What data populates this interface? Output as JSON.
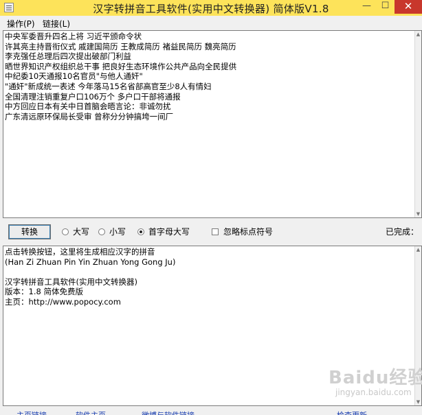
{
  "window": {
    "title": "汉字转拼音工具软件(实用中文转换器) 简体版V1.8",
    "controls": {
      "minimize": "—",
      "maximize": "☐",
      "close": "✕"
    }
  },
  "menu": {
    "items": [
      "操作(P)",
      "链接(L)"
    ]
  },
  "input_lines": [
    "中央军委晋升四名上将 习近平颁命令状",
    "许其亮主持晋衔仪式 戚建国简历 王教成简历 褚益民简历 魏亮简历",
    "李克强任总理后四次提出破部门利益",
    "晒世界知识产权组织总干事 把良好生态环境作公共产品向全民提供",
    "中纪委10天通报10名官员\"与他人通奸\"",
    "\"通奸\"新成统一表述 今年落马15名省部高官至少8人有情妇",
    "全国清理注销重复户口106万个 多户口干部将通报",
    "中方回应日本有关中日首脑会晤言论：非诚勿扰",
    "广东清远原环保局长受审 曾称分分钟搞垮一间厂"
  ],
  "toolbar": {
    "convert_label": "转换",
    "option_uppercase": "大写",
    "option_lowercase": "小写",
    "option_initial_caps": "首字母大写",
    "option_ignore_punct": "忽略标点符号",
    "selected_case": "首字母大写",
    "ignore_punct_checked": false,
    "status_label": "已完成："
  },
  "output_lines": [
    "点击转换按钮，这里将生成相应汉字的拼音",
    "(Han Zi Zhuan Pin Yin Zhuan Yong Gong Ju)",
    "",
    "汉字转拼音工具软件(实用中文转换器)",
    "版本：1.8 简体免费版",
    "主页：http://www.popocy.com"
  ],
  "footer_links": [
    "主页链接",
    "软件主页",
    "微博与软件链接",
    "检查更新"
  ],
  "watermark": {
    "logo": "Baidu经验",
    "url": "jingyan.baidu.com"
  }
}
